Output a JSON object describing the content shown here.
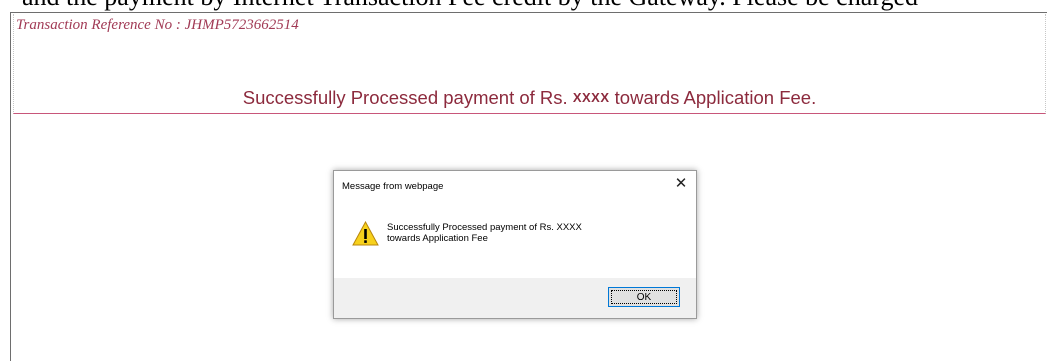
{
  "top_cropped_text": "and the payment by Internet Transaction Fee credit by the Gateway. Please be charged",
  "header": {
    "transaction_reference": "Transaction Reference No : JHMP5723662514",
    "success_prefix": "Successfully Processed payment of Rs.",
    "amount": "XXXX",
    "success_suffix": "towards Application Fee."
  },
  "dialog": {
    "title": "Message from webpage",
    "close_label": "✕",
    "message_line1": "Successfully Processed payment of Rs. XXXX",
    "message_line2": "towards Application Fee",
    "ok_label": "OK",
    "icon": "warning-icon"
  },
  "colors": {
    "accent_text": "#8c2a3d",
    "reference_text": "#a13a55",
    "divider": "#c8567a",
    "focus_border": "#0078d7"
  }
}
